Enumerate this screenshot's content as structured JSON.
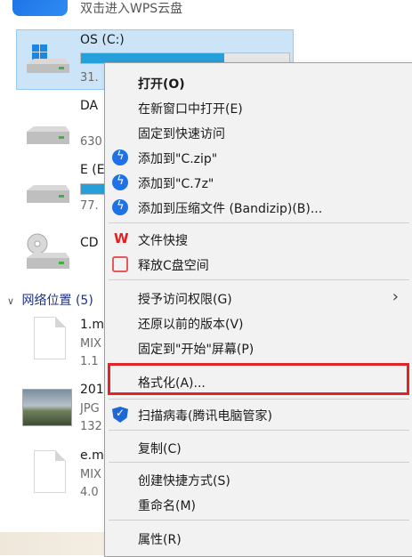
{
  "explorer": {
    "wps_cloud": "双击进入WPS云盘",
    "drives": [
      {
        "name": "OS (C:)",
        "free": "31.",
        "used_fraction": 0.69
      },
      {
        "name": "DA",
        "free": "630"
      },
      {
        "name": "E (E",
        "free": "77.",
        "used_fraction": 0.12
      },
      {
        "name": "CD"
      }
    ],
    "section": "网络位置 (5)",
    "files": [
      {
        "name": "1.m",
        "type": "MIX",
        "size": "1.1"
      },
      {
        "name": "201",
        "type": "JPG",
        "size": "132"
      },
      {
        "name": "e.m",
        "type": "MIX",
        "size": "4.0"
      }
    ]
  },
  "context_menu": {
    "items": [
      {
        "label": "打开(O)",
        "bold": true
      },
      {
        "label": "在新窗口中打开(E)"
      },
      {
        "label": "固定到快速访问"
      },
      {
        "label": "添加到\"C.zip\"",
        "icon": "bandizip-icon"
      },
      {
        "label": "添加到\"C.7z\"",
        "icon": "bandizip-icon"
      },
      {
        "label": "添加到压缩文件 (Bandizip)(B)...",
        "icon": "bandizip-icon"
      },
      {
        "label": "文件快搜",
        "icon": "wps-icon"
      },
      {
        "label": "释放C盘空间",
        "icon": "disk-clean-icon"
      },
      {
        "label": "授予访问权限(G)",
        "submenu": true
      },
      {
        "label": "还原以前的版本(V)"
      },
      {
        "label": "固定到\"开始\"屏幕(P)"
      },
      {
        "label": "格式化(A)...",
        "highlighted": true
      },
      {
        "label": "扫描病毒(腾讯电脑管家)",
        "icon": "shield-icon"
      },
      {
        "label": "复制(C)"
      },
      {
        "label": "创建快捷方式(S)"
      },
      {
        "label": "重命名(M)"
      },
      {
        "label": "属性(R)"
      }
    ],
    "submenu_arrow": "›",
    "highlight_color": "#e0242a"
  },
  "colors": {
    "selection": "#cce4f7",
    "progress": "#26a0da",
    "menu_bg": "#f2f2f2"
  }
}
